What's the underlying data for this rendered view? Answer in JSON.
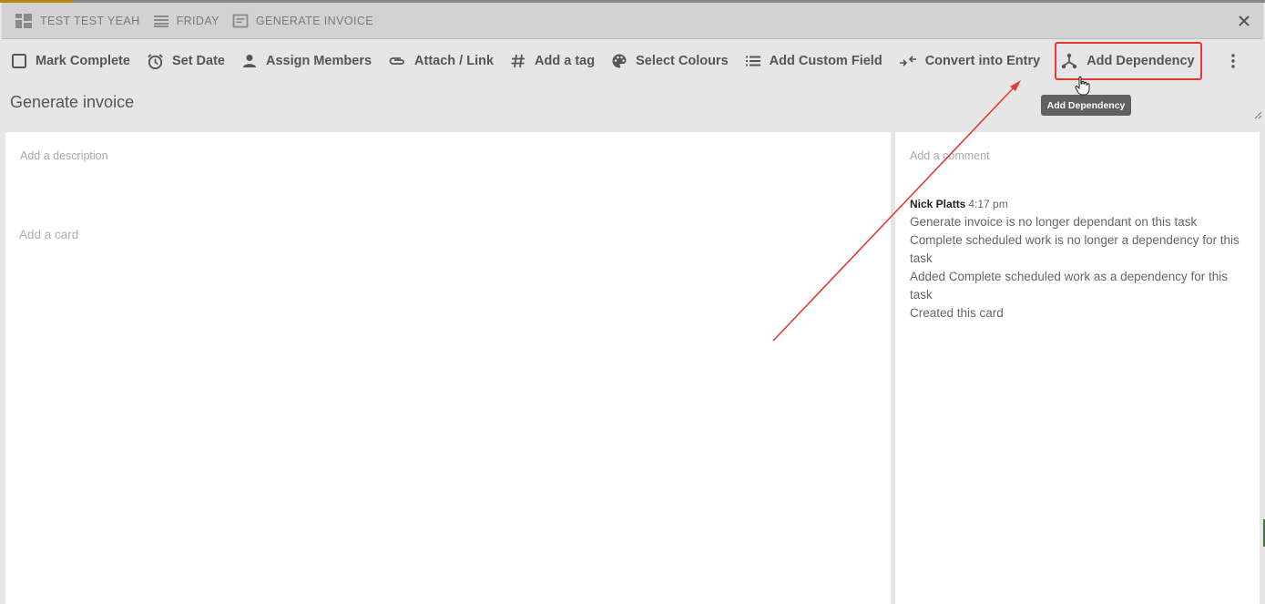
{
  "breadcrumb": [
    {
      "label": "TEST TEST YEAH",
      "icon": "board-icon"
    },
    {
      "label": "FRIDAY",
      "icon": "list-icon"
    },
    {
      "label": "GENERATE INVOICE",
      "icon": "card-icon"
    }
  ],
  "toolbar": {
    "mark_complete": "Mark Complete",
    "set_date": "Set Date",
    "assign_members": "Assign Members",
    "attach_link": "Attach / Link",
    "add_tag": "Add a tag",
    "select_colours": "Select Colours",
    "add_custom_field": "Add Custom Field",
    "convert_entry": "Convert into Entry",
    "add_dependency": "Add Dependency"
  },
  "tooltip": "Add Dependency",
  "card": {
    "title": "Generate invoice",
    "description_placeholder": "Add a description",
    "add_card_placeholder": "Add a card"
  },
  "comments": {
    "placeholder": "Add a comment",
    "activity": {
      "author": "Nick Platts",
      "time": "4:17 pm",
      "lines": [
        "Generate invoice is no longer dependant on this task",
        "Complete scheduled work is no longer a dependency for this task",
        "Added Complete scheduled work as a dependency for this task",
        "Created this card"
      ]
    }
  },
  "colors": {
    "highlight": "#e53935",
    "tooltip_bg": "#616161",
    "breadcrumb_bg": "#d2d2d2",
    "panel_bg": "#ffffff"
  }
}
